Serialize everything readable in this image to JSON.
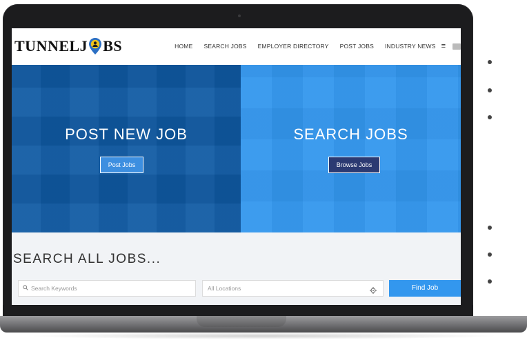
{
  "site": {
    "logo_left": "TUNNELJ",
    "logo_right": "BS"
  },
  "nav": {
    "items": [
      "HOME",
      "SEARCH JOBS",
      "EMPLOYER DIRECTORY",
      "POST JOBS",
      "INDUSTRY NEWS"
    ],
    "menu_glyph": "≡"
  },
  "hero": {
    "left_title": "POST NEW JOB",
    "left_button": "Post Jobs",
    "right_title": "SEARCH JOBS",
    "right_button": "Browse Jobs"
  },
  "search": {
    "heading": "SEARCH ALL JOBS...",
    "keywords_placeholder": "Search Keywords",
    "location_placeholder": "All Locations",
    "submit_label": "Find Job"
  },
  "colors": {
    "left_panel": "#0f5aa3",
    "right_panel": "#3397ee",
    "browse_button": "#2b3a72",
    "accent": "#3397ee"
  }
}
